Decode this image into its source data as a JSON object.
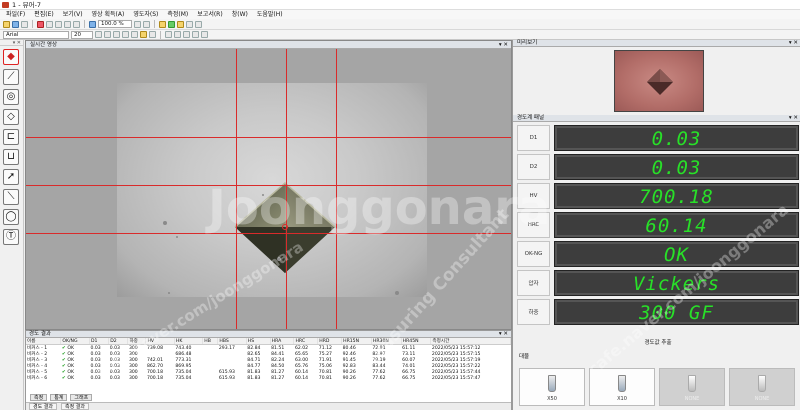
{
  "window": {
    "title": "1 - 뷰어-7"
  },
  "menu": [
    "파일(F)",
    "편집(E)",
    "보기(V)",
    "영상 획득(A)",
    "영도자(S)",
    "측정(M)",
    "보고서(R)",
    "창(W)",
    "도움말(H)"
  ],
  "toolbar": {
    "zoom": "100.0 %",
    "font": "Arial",
    "font_size": "20"
  },
  "live_panel": {
    "title": "실시간 영상"
  },
  "tools": [
    "diamond-tool-icon",
    "line-tool-icon",
    "brinell-tool-icon",
    "knoop-tool-icon",
    "bracket-tool-icon",
    "cup-tool-icon",
    "pointer-tool-icon",
    "slash-tool-icon",
    "circle-tool-icon",
    "text-tool-icon"
  ],
  "results": {
    "title": "경도 결과",
    "columns": [
      "이름",
      "OK/NG",
      "D1",
      "D2",
      "하중",
      "HV",
      "HK",
      "HB",
      "HBS",
      "HS",
      "HRA",
      "HRC",
      "HRD",
      "HR15N",
      "HR30N",
      "HR45N",
      "측정시간"
    ],
    "rows": [
      [
        "비커스 - 1",
        "OK",
        "0.03",
        "0.03",
        "300",
        "739.08",
        "743.40",
        "",
        "",
        "293.17",
        "82.84",
        "81.51",
        "62.02",
        "71.12",
        "80.46",
        "72.91",
        "61.11",
        "2022/05/23 15:57:12"
      ],
      [
        "비커스 - 2",
        "OK",
        "0.03",
        "0.03",
        "300",
        "",
        "686.48",
        "",
        "",
        "",
        "82.65",
        "84.41",
        "65.65",
        "75.27",
        "92.46",
        "82.97",
        "73.11",
        "2022/05/23 15:57:15"
      ],
      [
        "비커스 - 3",
        "OK",
        "0.03",
        "0.03",
        "300",
        "742.01",
        "773.31",
        "",
        "",
        "",
        "84.71",
        "82.24",
        "63.00",
        "71.91",
        "91.45",
        "79.19",
        "60.07",
        "2022/05/23 15:57:19"
      ],
      [
        "비커스 - 4",
        "OK",
        "0.03",
        "0.03",
        "300",
        "862.70",
        "869.95",
        "",
        "",
        "",
        "84.77",
        "84.50",
        "65.76",
        "75.06",
        "92.83",
        "83.44",
        "74.01",
        "2022/05/23 15:57:22"
      ],
      [
        "비커스 - 5",
        "OK",
        "0.03",
        "0.03",
        "300",
        "700.18",
        "735.04",
        "",
        "",
        "615.93",
        "81.83",
        "81.27",
        "60.14",
        "70.81",
        "90.26",
        "77.62",
        "66.75",
        "2022/05/23 15:57:44"
      ],
      [
        "비커스 - 6",
        "OK",
        "0.03",
        "0.03",
        "300",
        "700.18",
        "735.04",
        "",
        "",
        "615.93",
        "81.83",
        "81.27",
        "60.14",
        "70.81",
        "90.26",
        "77.62",
        "66.75",
        "2022/05/23 15:57:47"
      ]
    ],
    "tabs": [
      "측정",
      "통계",
      "그래프"
    ],
    "status_tabs": [
      "경도 결과",
      "측정 결과"
    ]
  },
  "preview": {
    "title": "미리보기"
  },
  "measurements": {
    "title": "경도계 패널",
    "rows": [
      {
        "label": "D1",
        "value": "0.03"
      },
      {
        "label": "D2",
        "value": "0.03"
      },
      {
        "label": "HV",
        "value": "700.18"
      },
      {
        "label": "HRC",
        "value": "60.14"
      },
      {
        "label": "OK-NG",
        "value": "OK"
      },
      {
        "label": "압자",
        "value": "Vickers"
      },
      {
        "label": "하중",
        "value": "300 GF"
      }
    ],
    "hardness_button": "경도값 추출"
  },
  "objectives": {
    "title": "대물",
    "items": [
      {
        "label": "X50",
        "active": true
      },
      {
        "label": "X10",
        "active": true
      },
      {
        "label": "NONE",
        "active": false
      },
      {
        "label": "NONE",
        "active": false
      }
    ]
  },
  "watermarks": [
    "cafe.naver.com/joonggonara",
    "Joonggonara",
    "Measuring Consultant",
    "cafe.naver.com/joonggonara"
  ],
  "colors": {
    "crosshair": "#d92b2b",
    "lcd_text": "#28e028",
    "lcd_bg": "#3d3d3d",
    "ok_check": "#1c9c1c"
  }
}
